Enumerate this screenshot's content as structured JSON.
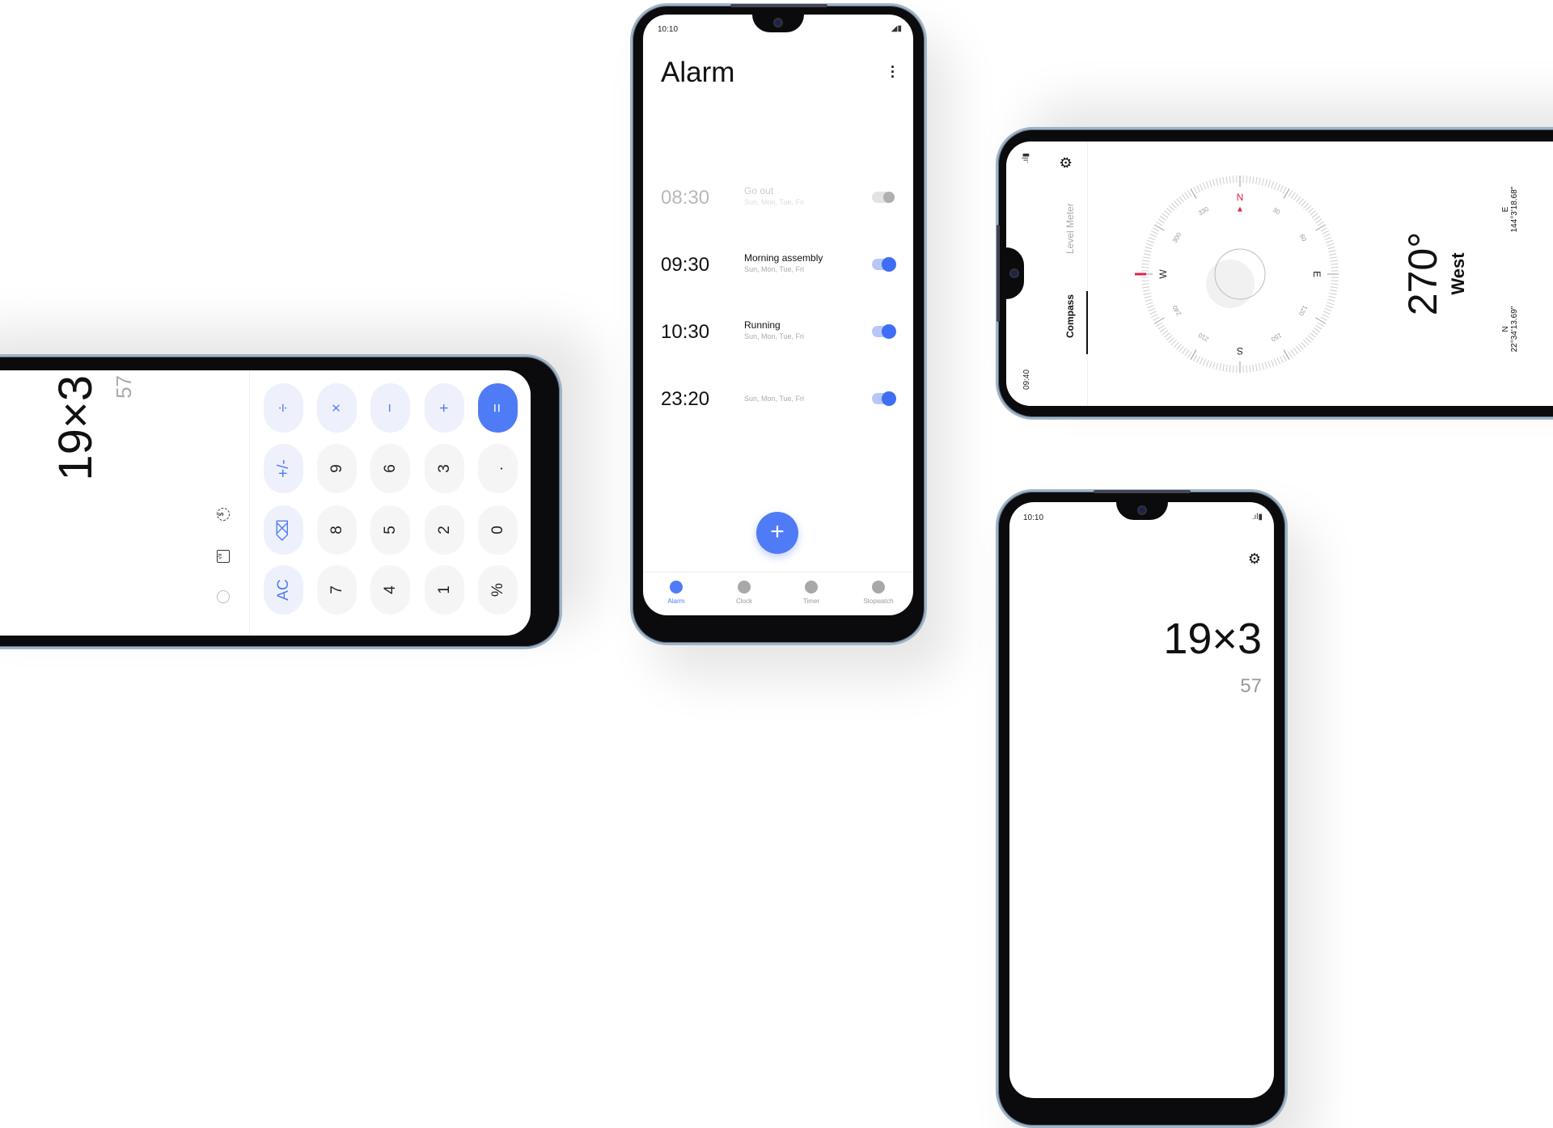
{
  "colors": {
    "accent": "#4f7cf6",
    "compass_red": "#e0224a",
    "frame": "#9fb4c6"
  },
  "calculator": {
    "expression": "19×3",
    "result": "57",
    "side_icons": [
      "history-icon",
      "scientific-icon",
      "currency-convert-icon"
    ],
    "keys": [
      [
        "AC",
        "⌫",
        "+/-",
        "÷"
      ],
      [
        "7",
        "8",
        "9",
        "×"
      ],
      [
        "4",
        "5",
        "6",
        "−"
      ],
      [
        "1",
        "2",
        "3",
        "+"
      ],
      [
        "%",
        "0",
        ".",
        "="
      ]
    ]
  },
  "alarm": {
    "status_time": "10:10",
    "title": "Alarm",
    "alarms": [
      {
        "time": "08:30",
        "label": "Go out",
        "days": "Sun, Mon, Tue, Fri",
        "enabled": false
      },
      {
        "time": "09:30",
        "label": "Morning assembly",
        "days": "Sun, Mon, Tue, Fri",
        "enabled": true
      },
      {
        "time": "10:30",
        "label": "Running",
        "days": "Sun, Mon, Tue, Fri",
        "enabled": true
      },
      {
        "time": "23:20",
        "label": "",
        "days": "Sun, Mon, Tue, Fri",
        "enabled": true
      }
    ],
    "add_label": "+",
    "nav": [
      {
        "label": "Alarm",
        "icon": "alarm-icon",
        "active": true
      },
      {
        "label": "Clock",
        "icon": "clock-icon"
      },
      {
        "label": "Timer",
        "icon": "hourglass-icon"
      },
      {
        "label": "Stopwatch",
        "icon": "stopwatch-icon"
      }
    ]
  },
  "compass": {
    "status_time": "09:40",
    "tabs": [
      {
        "label": "Compass",
        "active": true
      },
      {
        "label": "Level Meter"
      }
    ],
    "heading": "270°",
    "direction": "West",
    "heading_value": 270,
    "cardinals": {
      "N": "N",
      "E": "E",
      "S": "S",
      "W": "W"
    },
    "degree_labels": [
      "30",
      "60",
      "120",
      "150",
      "210",
      "240",
      "300",
      "330"
    ],
    "lat_label": "N",
    "lat": "22°34'13.69\"",
    "lon_label": "E",
    "lon": "144°3'18.68\""
  },
  "calc2": {
    "status_time": "10:10",
    "expression": "19×3",
    "result": "57"
  }
}
